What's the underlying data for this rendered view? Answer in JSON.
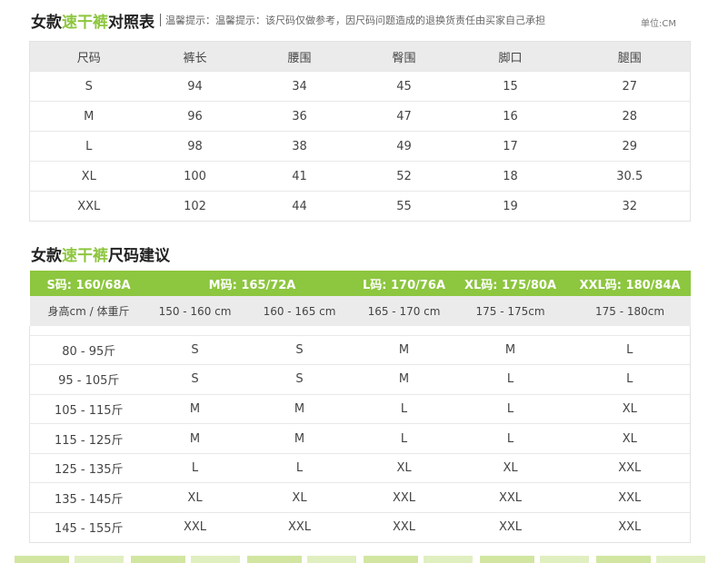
{
  "size_chart": {
    "title_part1": "女款",
    "title_green": "速干裤",
    "title_part2": "对照表",
    "tip": "温馨提示：温馨提示：该尺码仅做参考，因尺码问题造成的退换货责任由买家自己承担",
    "unit": "单位:CM",
    "headers": [
      "尺码",
      "裤长",
      "腰围",
      "臀围",
      "脚口",
      "腿围"
    ],
    "rows": [
      [
        "S",
        "94",
        "34",
        "45",
        "15",
        "27"
      ],
      [
        "M",
        "96",
        "36",
        "47",
        "16",
        "28"
      ],
      [
        "L",
        "98",
        "38",
        "49",
        "17",
        "29"
      ],
      [
        "XL",
        "100",
        "41",
        "52",
        "18",
        "30.5"
      ],
      [
        "XXL",
        "102",
        "44",
        "55",
        "19",
        "32"
      ]
    ]
  },
  "recommendation": {
    "title_part1": "女款",
    "title_green": "速干裤",
    "title_part2": "尺码建议",
    "size_labels": [
      "S码: 160/68A",
      "M码: 165/72A",
      "L码: 170/76A",
      "XL码: 175/80A",
      "XXL码: 180/84A"
    ],
    "range_row": [
      "身高cm / 体重斤",
      "150 - 160 cm",
      "160 - 165 cm",
      "165 - 170 cm",
      "175 - 175cm",
      "175 - 180cm"
    ],
    "rows": [
      [
        "80 - 95斤",
        "S",
        "S",
        "M",
        "M",
        "L"
      ],
      [
        "95 - 105斤",
        "S",
        "S",
        "M",
        "L",
        "L"
      ],
      [
        "105 - 115斤",
        "M",
        "M",
        "L",
        "L",
        "XL"
      ],
      [
        "115 - 125斤",
        "M",
        "M",
        "L",
        "L",
        "XL"
      ],
      [
        "125 - 135斤",
        "L",
        "L",
        "XL",
        "XL",
        "XXL"
      ],
      [
        "135 - 145斤",
        "XL",
        "XL",
        "XXL",
        "XXL",
        "XXL"
      ],
      [
        "145 - 155斤",
        "XXL",
        "XXL",
        "XXL",
        "XXL",
        "XXL"
      ]
    ]
  },
  "colors": {
    "accent": "#8dc63f",
    "header_bg": "#ebebeb",
    "text": "#444444"
  }
}
